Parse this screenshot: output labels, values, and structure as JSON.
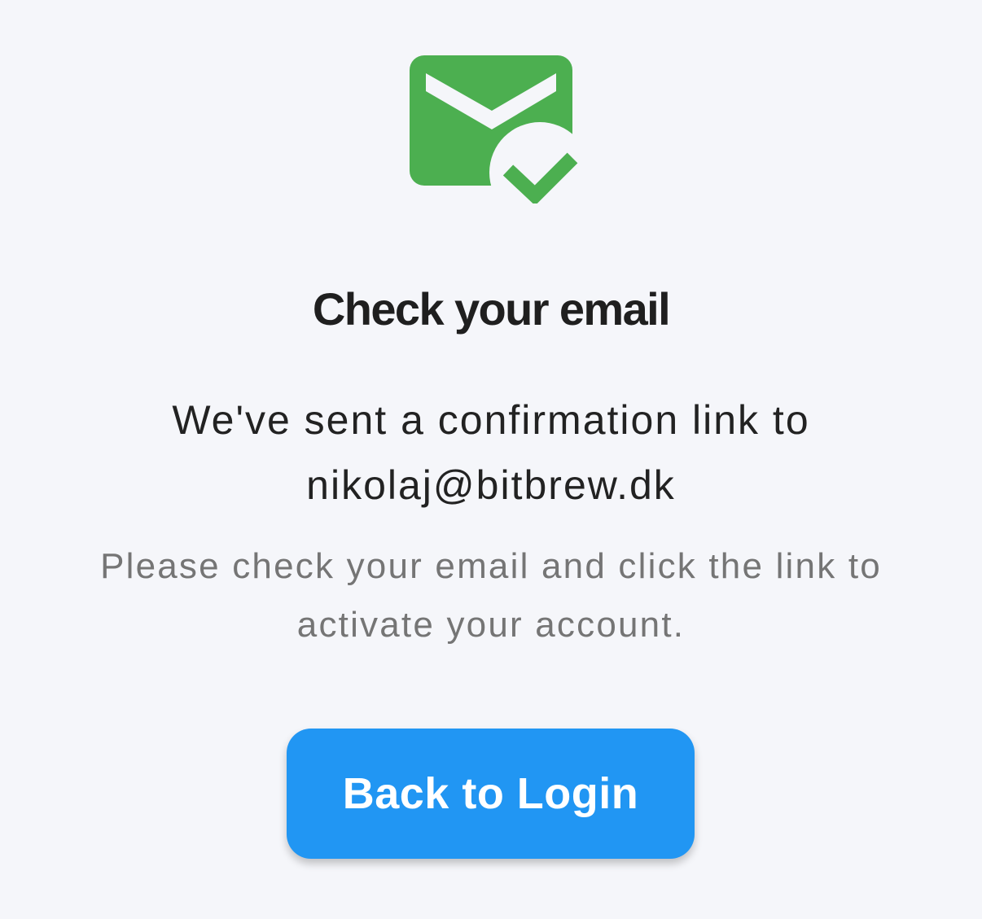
{
  "colors": {
    "accent": "#2196f3",
    "success": "#4caf50",
    "background": "#f5f6fa"
  },
  "icon": {
    "name": "mail-check-icon"
  },
  "title": "Check your email",
  "message": {
    "line1": "We've sent a confirmation link to",
    "email": "nikolaj@bitbrew.dk"
  },
  "subtext": {
    "line1": "Please check your email and click the link to",
    "line2": "activate your account."
  },
  "button": {
    "label": "Back to Login"
  }
}
